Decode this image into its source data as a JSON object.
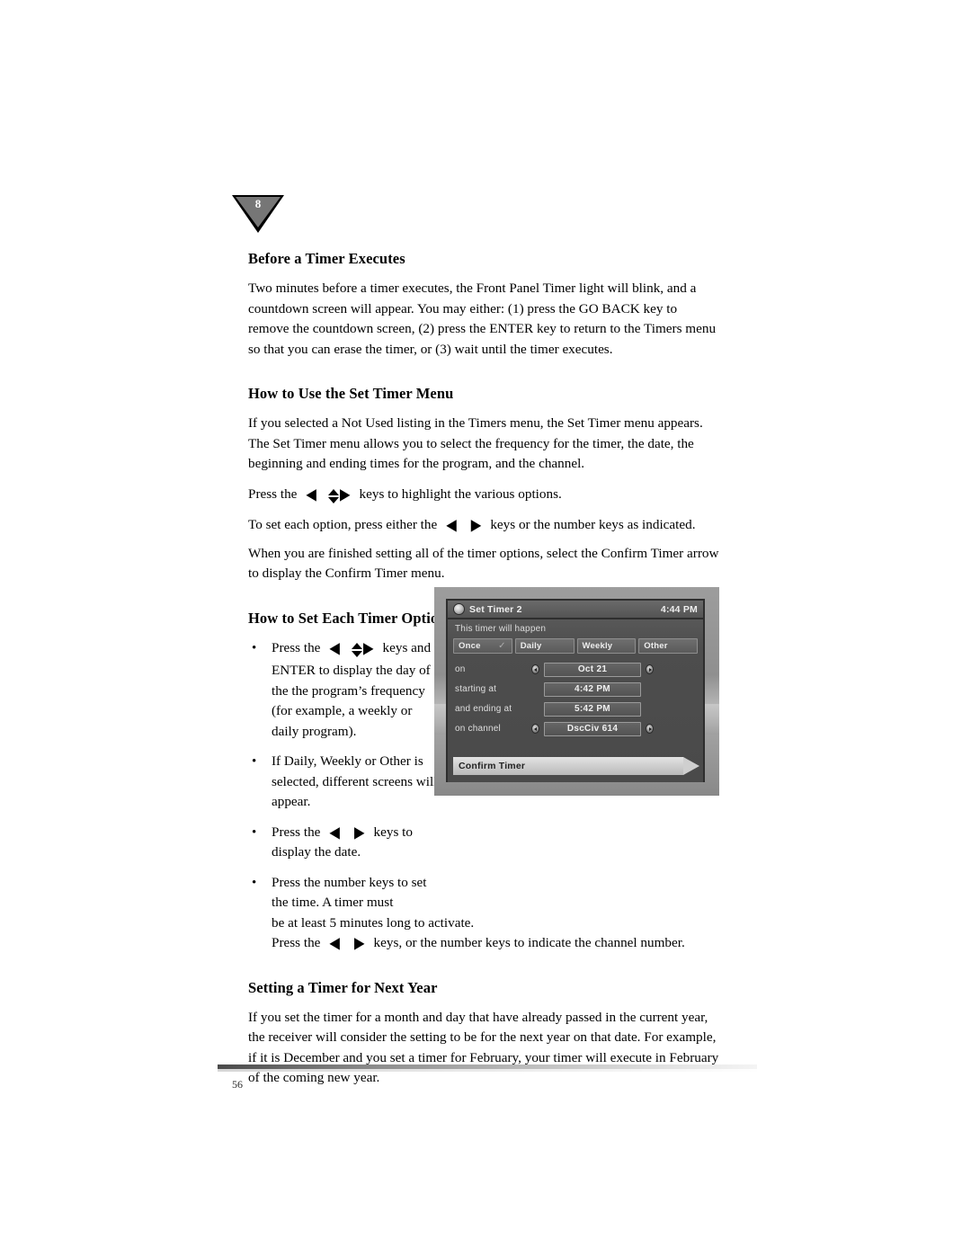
{
  "page": {
    "chapter_marker": "8",
    "page_number": "56"
  },
  "sections": [
    {
      "heading": "Before a Timer Executes",
      "paragraphs": [
        "Two minutes before a timer executes, the Front Panel Timer light will blink, and a countdown screen will appear. You may either: (1) press the GO BACK key to remove the countdown screen, (2) press the ENTER key to return to the Timers menu so that you can erase the timer, or (3) wait until the timer executes."
      ]
    },
    {
      "heading": "How to Use the Set Timer Menu",
      "paragraphs": [
        "If you selected a Not Used listing in the Timers menu, the Set Timer menu appears. The Set Timer menu allows you to select the frequency for the timer, the date, the beginning and ending times for the program, and the channel."
      ],
      "key_lines": [
        {
          "before": "Press the",
          "after": "keys to highlight the various options.",
          "arrows": "left-updown-right"
        },
        {
          "before": "To set each option, press either the",
          "after": "keys or the number keys as indicated.",
          "arrows": "left-right"
        }
      ],
      "closing": "When you are finished setting all of the timer options, select the Confirm Timer arrow to display the Confirm Timer menu."
    },
    {
      "heading": "How to Set Each Timer Option",
      "bullets": [
        {
          "before": "Press the",
          "after": "keys and ENTER to display the day of the the program’s frequency (for example, a weekly or daily program).",
          "arrows": "left-updown-right"
        },
        {
          "before": "If Daily, Weekly or Other is selected, different screens will appear.",
          "after": "",
          "arrows": "none"
        },
        {
          "before": "Press the",
          "after": "keys to display the date.",
          "arrows": "left-right"
        },
        {
          "before": "Press the number keys to set the time. A timer must",
          "after": "",
          "arrows": "none"
        }
      ],
      "continuation_lines": [
        "be at least 5 minutes long to activate."
      ],
      "continuation_key_line": {
        "before": "Press the",
        "after": "keys, or the number keys to indicate the channel number.",
        "arrows": "left-right"
      }
    },
    {
      "heading": "Setting a Timer for Next Year",
      "paragraphs": [
        "If you set the timer for a month and day that have already passed in the current year, the receiver will consider the setting to be for the next year on that date. For example, if it is December and you set a timer for February, your timer will execute in February of the coming new year."
      ]
    }
  ],
  "figure": {
    "name": "set-timer-osd-screenshot",
    "title": "Set Timer 2",
    "clock": "4:44 PM",
    "prompt": "This timer will happen",
    "frequency_options": [
      {
        "label": "Once",
        "selected": true,
        "check": "✓"
      },
      {
        "label": "Daily",
        "selected": false,
        "check": ""
      },
      {
        "label": "Weekly",
        "selected": false,
        "check": ""
      },
      {
        "label": "Other",
        "selected": false,
        "check": ""
      }
    ],
    "fields": [
      {
        "label": "on",
        "value": "Oct 21",
        "spinners": true
      },
      {
        "label": "starting at",
        "value": "4:42 PM",
        "spinners": false
      },
      {
        "label": "and ending at",
        "value": "5:42 PM",
        "spinners": false
      },
      {
        "label": "on channel",
        "value": "DscCiv 614",
        "spinners": true
      }
    ],
    "confirm_label": "Confirm Timer"
  },
  "glyphs": {
    "bullet": "•",
    "arrow_left": "◀",
    "arrow_right": "▶"
  }
}
